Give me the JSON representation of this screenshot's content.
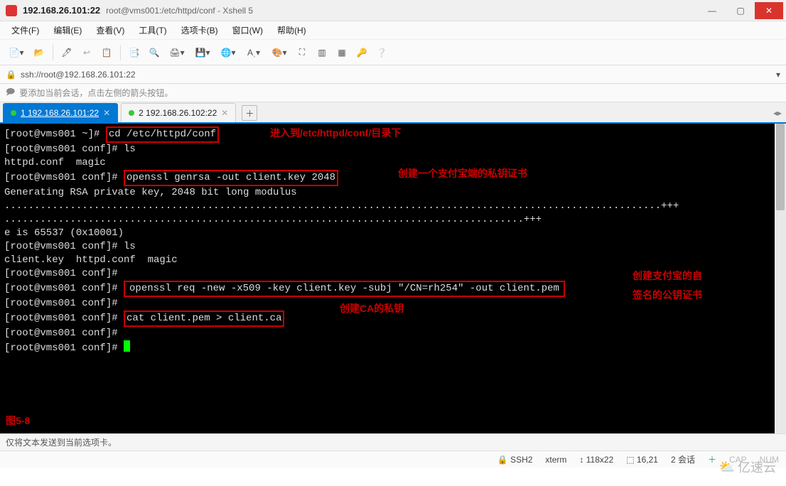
{
  "title": {
    "ip": "192.168.26.101:22",
    "path": "root@vms001:/etc/httpd/conf - Xshell 5"
  },
  "menu": {
    "file": "文件(F)",
    "edit": "编辑(E)",
    "view": "查看(V)",
    "tools": "工具(T)",
    "tabs": "选项卡(B)",
    "window": "窗口(W)",
    "help": "帮助(H)"
  },
  "address": {
    "url": "ssh://root@192.168.26.101:22",
    "lock": "🔒"
  },
  "tip": {
    "icon": "🗩",
    "text": "要添加当前会话，点击左侧的箭头按钮。"
  },
  "tabs": {
    "items": [
      {
        "label": "1 192.168.26.101:22",
        "active": true
      },
      {
        "label": "2 192.168.26.102:22",
        "active": false
      }
    ]
  },
  "term": {
    "p1": "[root@vms001 ~]# ",
    "p2": "[root@vms001 conf]# ",
    "cmd_cd": "cd /etc/httpd/conf",
    "cmd_ls": "ls",
    "out_ls1": "httpd.conf  magic",
    "cmd_genrsa": "openssl genrsa -out client.key 2048",
    "out_gen": "Generating RSA private key, 2048 bit long modulus",
    "out_dots1": "..............................................................................................................+++",
    "out_dots2": ".......................................................................................+++",
    "out_e": "e is 65537 (0x10001)",
    "out_ls2": "client.key  httpd.conf  magic",
    "cmd_req": "openssl req -new -x509 -key client.key -subj \"/CN=rh254\" -out client.pem",
    "cmd_cat": "cat client.pem > client.ca"
  },
  "anno": {
    "a1": "进入到/etc/httpd/conf/目录下",
    "a2": "创建一个支付宝端的私钥证书",
    "a3": "创建支付宝的自",
    "a3b": "签名的公钥证书",
    "a4": "创建CA的私钥",
    "fig": "图5-8"
  },
  "footer": {
    "text": "仅将文本发送到当前选项卡。"
  },
  "status": {
    "proto": "SSH2",
    "term": "xterm",
    "size": "118x22",
    "pos": "16,21",
    "sess": "2 会话"
  },
  "watermark": {
    "cloud": "⛅",
    "text": "亿速云"
  },
  "icons": {
    "mini": "—",
    "max": "▢",
    "close": "✕",
    "dd": "▾",
    "ldq": "◂▸",
    "plus": "＋",
    "arr_up": "↕",
    "cap": "CAP",
    "num": "NUM",
    "lock_s": "🔒"
  }
}
